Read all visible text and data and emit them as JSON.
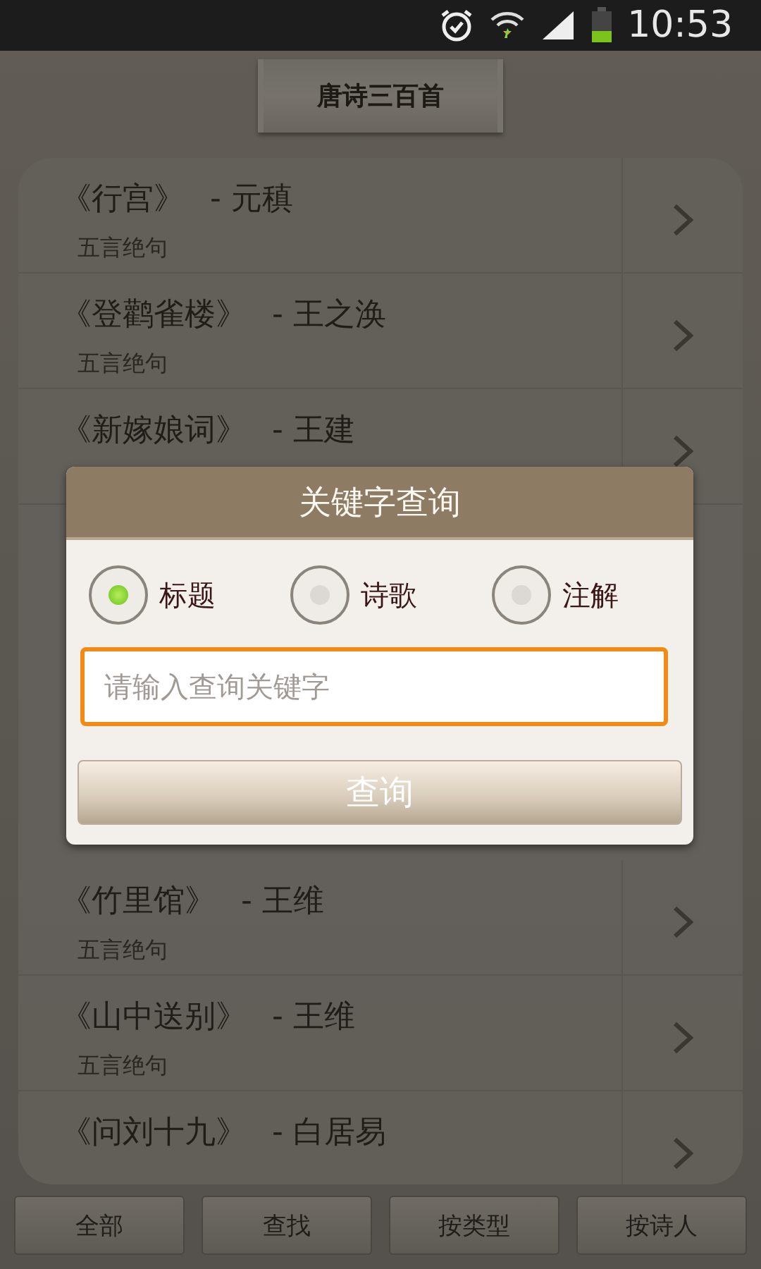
{
  "status_bar": {
    "time": "10:53"
  },
  "header": {
    "title": "唐诗三百首"
  },
  "poems_above": [
    {
      "title": "《行宫》",
      "author": "- 元稹",
      "category": "五言绝句"
    },
    {
      "title": "《登鹳雀楼》",
      "author": "- 王之涣",
      "category": "五言绝句"
    },
    {
      "title": "《新嫁娘词》",
      "author": "- 王建"
    }
  ],
  "poems_below": [
    {
      "title": "《竹里馆》",
      "author": "- 王维",
      "category": "五言绝句"
    },
    {
      "title": "《山中送别》",
      "author": "- 王维",
      "category": "五言绝句"
    },
    {
      "title": "《问刘十九》",
      "author": "- 白居易"
    }
  ],
  "dialog": {
    "title": "关键字查询",
    "options": [
      {
        "label": "标题",
        "selected": true
      },
      {
        "label": "诗歌",
        "selected": false
      },
      {
        "label": "注解",
        "selected": false
      }
    ],
    "search": {
      "placeholder": "请输入查询关键字"
    },
    "button": "查询"
  },
  "bottom_buttons": [
    "全部",
    "查找",
    "按类型",
    "按诗人"
  ]
}
